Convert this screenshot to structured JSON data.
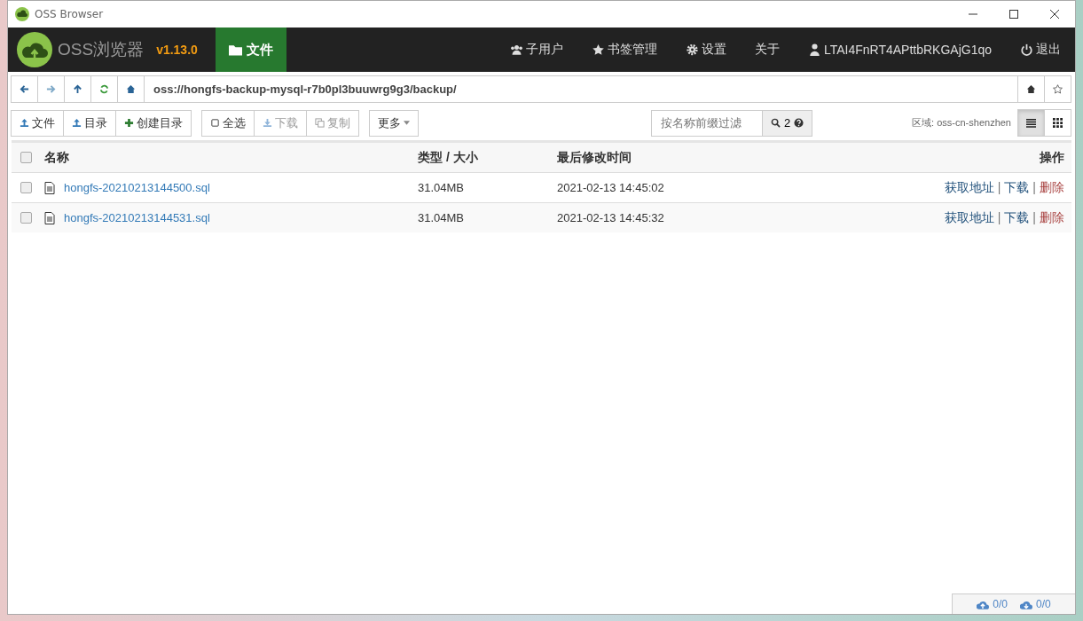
{
  "window": {
    "title": "OSS Browser"
  },
  "app": {
    "name": "OSS浏览器",
    "version": "v1.13.0"
  },
  "nav_tabs": [
    {
      "label": "文件",
      "kind": "folder",
      "selected": true
    }
  ],
  "nav_menu": [
    {
      "label": "子用户",
      "kind": "users"
    },
    {
      "label": "书签管理",
      "kind": "star"
    },
    {
      "label": "设置",
      "kind": "gear"
    },
    {
      "label": "关于",
      "kind": "plain"
    },
    {
      "label": "LTAI4FnRT4APttbRKGAjG1qo",
      "kind": "user"
    },
    {
      "label": "退出",
      "kind": "power"
    }
  ],
  "path_bar": {
    "value": "oss://hongfs-backup-mysql-r7b0pl3buuwrg9g3/backup/"
  },
  "toolbar_groups": [
    [
      {
        "label": "文件",
        "kind": "upload",
        "disabled": false
      },
      {
        "label": "目录",
        "kind": "upload",
        "disabled": false
      },
      {
        "label": "创建目录",
        "kind": "plus",
        "disabled": false
      }
    ],
    [
      {
        "label": "全选",
        "kind": "square",
        "disabled": false
      },
      {
        "label": "下载",
        "kind": "download",
        "disabled": true
      },
      {
        "label": "复制",
        "kind": "copy",
        "disabled": true
      }
    ],
    [
      {
        "label": "更多",
        "kind": "dropdown",
        "disabled": false
      }
    ]
  ],
  "filter": {
    "placeholder": "按名称前缀过滤",
    "count": "2"
  },
  "region": "区域: oss-cn-shenzhen",
  "view_modes": [
    {
      "kind": "list",
      "selected": true
    },
    {
      "kind": "grid",
      "selected": false
    }
  ],
  "table": {
    "select_all_checked": false,
    "columns": [
      "名称",
      "类型 / 大小",
      "最后修改时间",
      "操作"
    ],
    "rows": [
      {
        "checked": false,
        "name": "hongfs-20210213144500.sql",
        "size": "31.04MB",
        "modified": "2021-02-13 14:45:02",
        "actions": [
          {
            "kind": "link",
            "text": "获取地址"
          },
          {
            "kind": "separator",
            "text": "|"
          },
          {
            "kind": "link",
            "text": "下载"
          },
          {
            "kind": "separator",
            "text": "|"
          },
          {
            "kind": "danger",
            "text": "删除"
          }
        ]
      },
      {
        "checked": false,
        "name": "hongfs-20210213144531.sql",
        "size": "31.04MB",
        "modified": "2021-02-13 14:45:32",
        "actions": [
          {
            "kind": "link",
            "text": "获取地址"
          },
          {
            "kind": "separator",
            "text": "|"
          },
          {
            "kind": "link",
            "text": "下载"
          },
          {
            "kind": "separator",
            "text": "|"
          },
          {
            "kind": "danger",
            "text": "删除"
          }
        ]
      }
    ]
  },
  "transfers": {
    "upload": "0/0",
    "download": "0/0"
  }
}
